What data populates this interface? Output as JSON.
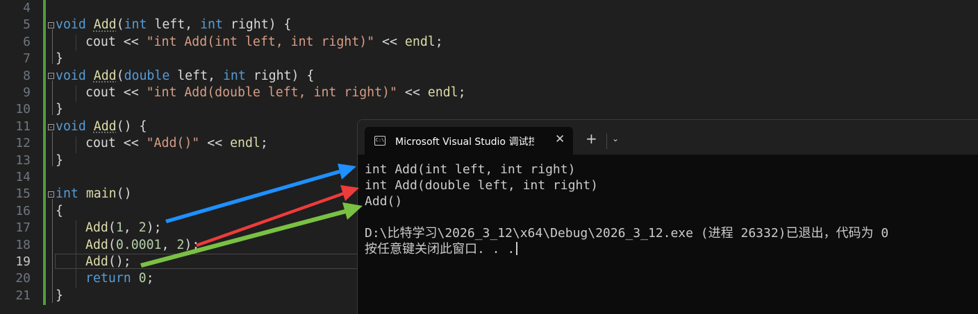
{
  "editor": {
    "line_numbers": [
      "4",
      "5",
      "6",
      "7",
      "8",
      "9",
      "10",
      "11",
      "12",
      "13",
      "14",
      "15",
      "16",
      "17",
      "18",
      "19",
      "20",
      "21"
    ],
    "active_line": "19",
    "lines": {
      "l5": {
        "kw": "void",
        "fn": "Add",
        "open": "(",
        "t1": "int",
        "p1": " left, ",
        "t2": "int",
        "p2": " right) {"
      },
      "l6": {
        "a": "cout << ",
        "s": "\"int Add(int left, int right)\"",
        "b": " << ",
        "c": "endl",
        ";": ";"
      },
      "l7": "}",
      "l8": {
        "kw": "void",
        "fn": "Add",
        "open": "(",
        "t1": "double",
        "p1": " left, ",
        "t2": "int",
        "p2": " right) {"
      },
      "l9": {
        "a": "cout << ",
        "s": "\"int Add(double left, int right)\"",
        "b": " << ",
        "c": "endl",
        ";": ";"
      },
      "l10": "}",
      "l11": {
        "kw": "void",
        "fn": "Add",
        "rest": "() {"
      },
      "l12": {
        "a": "cout << ",
        "s": "\"Add()\"",
        "b": " << ",
        "c": "endl",
        ";": ";"
      },
      "l13": "}",
      "l15": {
        "kw": "int",
        "fn": "main",
        "rest": "()"
      },
      "l16": "{",
      "l17": {
        "fn": "Add",
        "a": "(",
        "n1": "1",
        ",": ", ",
        "n2": "2",
        "end": ");"
      },
      "l18": {
        "fn": "Add",
        "a": "(",
        "n1": "0.0001",
        ",": ", ",
        "n2": "2",
        "end": ");"
      },
      "l19": {
        "fn": "Add",
        "end": "();"
      },
      "l20": {
        "kw": "return",
        "sp": " ",
        "n": "0",
        "end": ";"
      },
      "l21": "}"
    }
  },
  "console": {
    "tab_title": "Microsoft Visual Studio 调试控",
    "tab_icon_text": "C:\\",
    "close_glyph": "✕",
    "new_tab_glyph": "+",
    "dropdown_glyph": "⌄",
    "output": [
      "int Add(int left, int right)",
      "int Add(double left, int right)",
      "Add()",
      "",
      "D:\\比特学习\\2026_3_12\\x64\\Debug\\2026_3_12.exe (进程 26332)已退出，代码为 0",
      "按任意键关闭此窗口. . ."
    ]
  },
  "annotations": {
    "arrow_colors": [
      "#1e90ff",
      "#ee3b3b",
      "#7ac143"
    ]
  }
}
